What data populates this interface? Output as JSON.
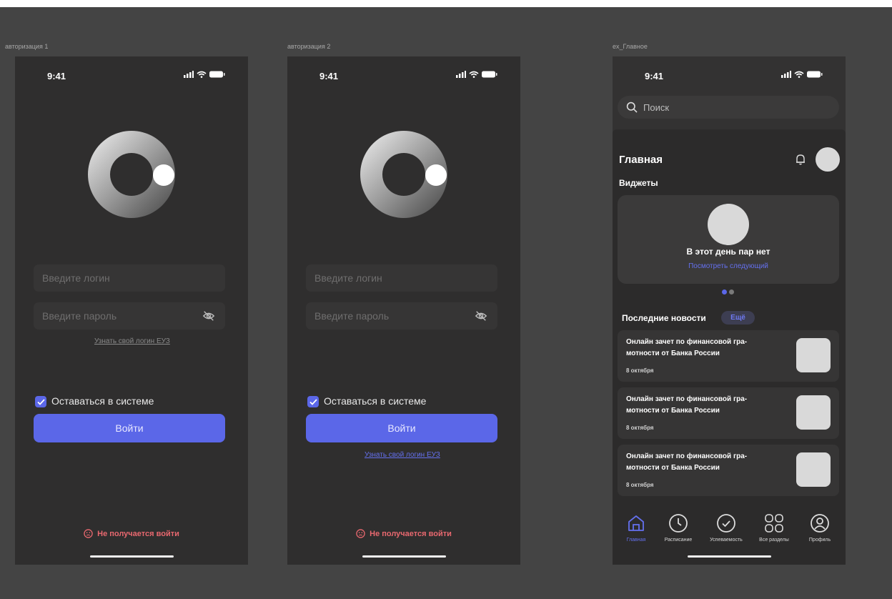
{
  "frames": {
    "auth1_label": "авторизация 1",
    "auth2_label": "авторизация 2",
    "main_label": "ex_Главное"
  },
  "status": {
    "time": "9:41"
  },
  "auth": {
    "login_placeholder": "Введите логин",
    "password_placeholder": "Введите пароль",
    "find_login_link": "Узнать свой логин ЕУЗ",
    "stay_signed_in": "Оставаться в системе",
    "stay_signed_in_checked": true,
    "login_button": "Войти",
    "trouble_link": "Не получается войти"
  },
  "main": {
    "search_placeholder": "Поиск",
    "title": "Главная",
    "widgets_header": "Виджеты",
    "widget": {
      "title": "В этот день пар нет",
      "link": "Посмотреть следующий",
      "page_index": 1,
      "page_count": 2
    },
    "news_header": "Последние новости",
    "news_more": "Ещё",
    "news": [
      {
        "title": "Онлайн зачет по финансовой гра-мотности от Банка России",
        "date": "8 октября"
      },
      {
        "title": "Онлайн зачет по финансовой гра-мотности от Банка России",
        "date": "8 октября"
      },
      {
        "title": "Онлайн зачет по финансовой гра-мотности от Банка России",
        "date": "8 октября"
      }
    ],
    "tabs": [
      {
        "label": "Главная",
        "icon": "home-icon",
        "active": true
      },
      {
        "label": "Расписание",
        "icon": "clock-icon",
        "active": false
      },
      {
        "label": "Успеваемость",
        "icon": "check-circle-icon",
        "active": false
      },
      {
        "label": "Все разделы",
        "icon": "grid-icon",
        "active": false
      },
      {
        "label": "Профиль",
        "icon": "profile-icon",
        "active": false
      }
    ]
  },
  "colors": {
    "accent": "#5b67e8",
    "link_blue": "#6470ee",
    "error": "#e8686f",
    "background": "#444444",
    "screen": "#2f2e2e"
  }
}
